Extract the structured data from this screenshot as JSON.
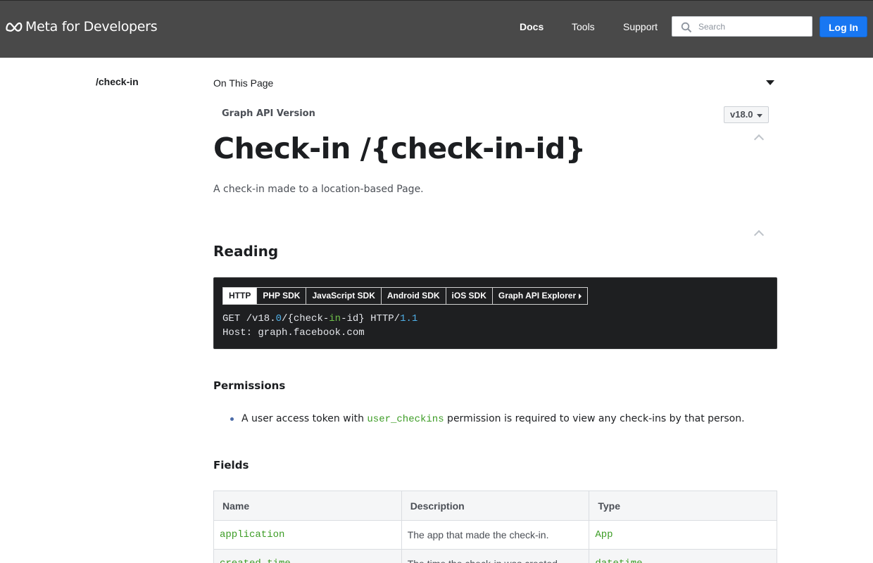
{
  "header": {
    "brand": "Meta for Developers",
    "nav": [
      "Docs",
      "Tools",
      "Support"
    ],
    "search_placeholder": "Search",
    "login_label": "Log In",
    "colors": {
      "bar": "#494949",
      "login": "#1877f2"
    }
  },
  "sidebar": {
    "current": "/check-in"
  },
  "on_this_page": {
    "label": "On This Page"
  },
  "version": {
    "label": "Graph API Version",
    "selected": "v18.0"
  },
  "page": {
    "title": "Check-in /{check-in-id}",
    "description": "A check-in made to a location-based Page."
  },
  "reading": {
    "heading": "Reading",
    "tabs": [
      "HTTP",
      "PHP SDK",
      "JavaScript SDK",
      "Android SDK",
      "iOS SDK",
      "Graph API Explorer"
    ],
    "active_tab": "HTTP",
    "code": {
      "line1": {
        "a": "GET /v18.",
        "b": "0",
        "c": "/{check-",
        "d": "in",
        "e": "-id} HTTP/",
        "f": "1.1"
      },
      "line2": "Host: graph.facebook.com"
    }
  },
  "permissions": {
    "heading": "Permissions",
    "items": [
      {
        "pre": "A user access token with ",
        "code": "user_checkins",
        "post": " permission is required to view any check-ins by that person."
      }
    ]
  },
  "fields": {
    "heading": "Fields",
    "columns": [
      "Name",
      "Description",
      "Type"
    ],
    "rows": [
      {
        "name": "application",
        "description": "The app that made the check-in.",
        "type": "App"
      },
      {
        "name": "created_time",
        "description": "The time the check-in was created.",
        "type": "datetime"
      }
    ]
  }
}
